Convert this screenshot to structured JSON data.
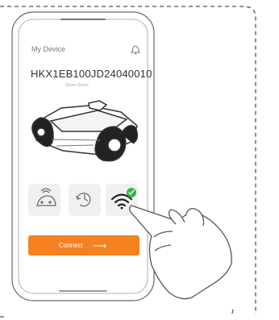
{
  "device": {
    "title": "My Device",
    "id": "HKX1EB100JD24040010",
    "series": "Storm Series"
  },
  "actions": {
    "connect_label": "Connect"
  },
  "colors": {
    "accent": "#f58220",
    "tile_bg": "#f0f0f0",
    "success": "#37b34a",
    "line": "#777777"
  },
  "icons": [
    "bell-icon",
    "robot-mower-illustration",
    "remote-control-icon",
    "history-icon",
    "wifi-icon",
    "checkmark-icon",
    "pointing-hand-illustration"
  ]
}
